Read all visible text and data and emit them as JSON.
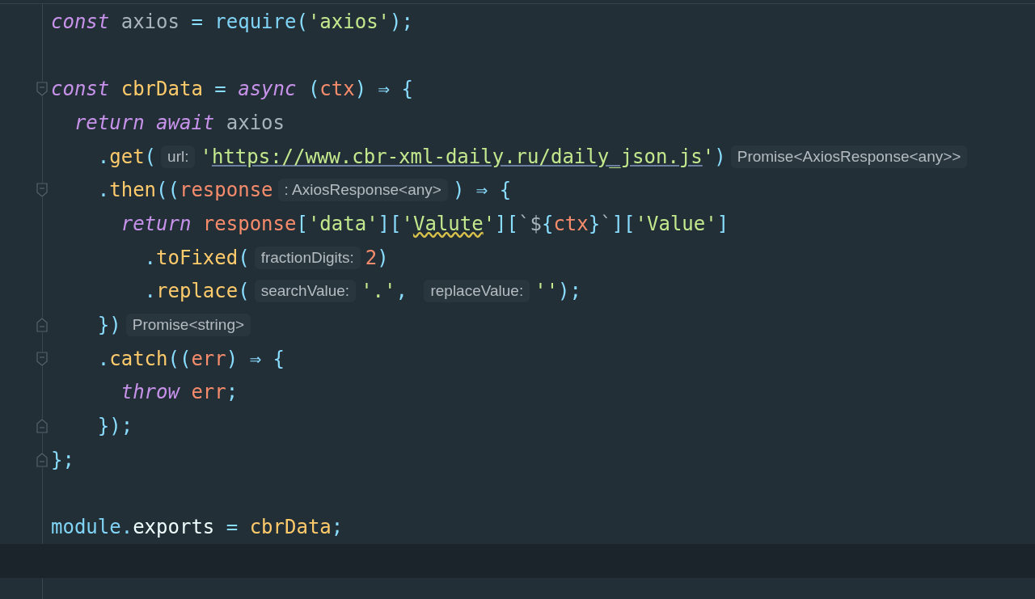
{
  "editor": {
    "lines": [
      {
        "fold_start": false,
        "fold_end": false,
        "current": false,
        "tokens": [
          {
            "text": "const",
            "kind": "keyword"
          },
          {
            "text": " axios ",
            "kind": "variable"
          },
          {
            "text": "=",
            "kind": "operator"
          },
          {
            "text": " require",
            "kind": "function"
          },
          {
            "text": "(",
            "kind": "punct"
          },
          {
            "text": "'axios'",
            "kind": "string"
          },
          {
            "text": ");",
            "kind": "punct"
          }
        ]
      },
      {
        "fold_start": false,
        "fold_end": false,
        "current": false
      },
      {
        "fold_start": true,
        "fold_end": false,
        "current": false,
        "tokens": [
          {
            "text": "const",
            "kind": "keyword"
          },
          {
            "text": " cbrData ",
            "kind": "name"
          },
          {
            "text": "= ",
            "kind": "operator"
          },
          {
            "text": "async",
            "kind": "keyword"
          },
          {
            "text": " (",
            "kind": "punct"
          },
          {
            "text": "ctx",
            "kind": "param"
          },
          {
            "text": ") ⇒ {",
            "kind": "punct"
          }
        ]
      },
      {
        "fold_start": false,
        "fold_end": false,
        "current": false,
        "tokens": [
          {
            "text": "  return await",
            "kind": "keyword"
          },
          {
            "text": " axios",
            "kind": "variable"
          }
        ]
      },
      {
        "fold_start": false,
        "fold_end": false,
        "current": false,
        "tokens": [
          {
            "text": "    .",
            "kind": "punct"
          },
          {
            "text": "get",
            "kind": "method"
          },
          {
            "text": "(",
            "kind": "punct"
          },
          {
            "text": "url:",
            "kind": "hint"
          },
          {
            "text": "'",
            "kind": "string"
          },
          {
            "text": "https://www.cbr-xml-daily.ru/daily_json.js",
            "kind": "url"
          },
          {
            "text": "'",
            "kind": "string"
          },
          {
            "text": ")",
            "kind": "punct"
          },
          {
            "text": "Promise<AxiosResponse<any>>",
            "kind": "hint"
          }
        ]
      },
      {
        "fold_start": true,
        "fold_end": false,
        "current": false,
        "tokens": [
          {
            "text": "    .",
            "kind": "punct"
          },
          {
            "text": "then",
            "kind": "method"
          },
          {
            "text": "((",
            "kind": "punct"
          },
          {
            "text": "response",
            "kind": "param"
          },
          {
            "text": ": AxiosResponse<any>",
            "kind": "hint"
          },
          {
            "text": ") ⇒ {",
            "kind": "punct"
          }
        ]
      },
      {
        "fold_start": false,
        "fold_end": false,
        "current": false,
        "tokens": [
          {
            "text": "      return",
            "kind": "keyword"
          },
          {
            "text": " response",
            "kind": "param"
          },
          {
            "text": "[",
            "kind": "punct"
          },
          {
            "text": "'data'",
            "kind": "string"
          },
          {
            "text": "][",
            "kind": "punct"
          },
          {
            "text": "'",
            "kind": "string"
          },
          {
            "text": "Valute",
            "kind": "warning"
          },
          {
            "text": "'",
            "kind": "string"
          },
          {
            "text": "][",
            "kind": "punct"
          },
          {
            "text": "`$",
            "kind": "variable"
          },
          {
            "text": "{",
            "kind": "punct"
          },
          {
            "text": "ctx",
            "kind": "param"
          },
          {
            "text": "}",
            "kind": "punct"
          },
          {
            "text": "`",
            "kind": "variable"
          },
          {
            "text": "][",
            "kind": "punct"
          },
          {
            "text": "'Value'",
            "kind": "string"
          },
          {
            "text": "]",
            "kind": "punct"
          }
        ]
      },
      {
        "fold_start": false,
        "fold_end": false,
        "current": false,
        "tokens": [
          {
            "text": "        .",
            "kind": "punct"
          },
          {
            "text": "toFixed",
            "kind": "method"
          },
          {
            "text": "(",
            "kind": "punct"
          },
          {
            "text": "fractionDigits:",
            "kind": "hint"
          },
          {
            "text": "2",
            "kind": "number"
          },
          {
            "text": ")",
            "kind": "punct"
          }
        ]
      },
      {
        "fold_start": false,
        "fold_end": false,
        "current": false,
        "tokens": [
          {
            "text": "        .",
            "kind": "punct"
          },
          {
            "text": "replace",
            "kind": "method"
          },
          {
            "text": "(",
            "kind": "punct"
          },
          {
            "text": "searchValue:",
            "kind": "hint"
          },
          {
            "text": "'.'",
            "kind": "string"
          },
          {
            "text": ", ",
            "kind": "punct"
          },
          {
            "text": "replaceValue:",
            "kind": "hint"
          },
          {
            "text": "''",
            "kind": "string"
          },
          {
            "text": ");",
            "kind": "punct"
          }
        ]
      },
      {
        "fold_start": false,
        "fold_end": true,
        "current": false,
        "tokens": [
          {
            "text": "    })",
            "kind": "punct"
          },
          {
            "text": "Promise<string>",
            "kind": "hint"
          }
        ]
      },
      {
        "fold_start": true,
        "fold_end": false,
        "current": false,
        "tokens": [
          {
            "text": "    .",
            "kind": "punct"
          },
          {
            "text": "catch",
            "kind": "method"
          },
          {
            "text": "((",
            "kind": "punct"
          },
          {
            "text": "err",
            "kind": "param"
          },
          {
            "text": ") ⇒ {",
            "kind": "punct"
          }
        ]
      },
      {
        "fold_start": false,
        "fold_end": false,
        "current": false,
        "tokens": [
          {
            "text": "      throw",
            "kind": "keyword"
          },
          {
            "text": " err",
            "kind": "param"
          },
          {
            "text": ";",
            "kind": "punct"
          }
        ]
      },
      {
        "fold_start": false,
        "fold_end": true,
        "current": false,
        "tokens": [
          {
            "text": "    });",
            "kind": "punct"
          }
        ]
      },
      {
        "fold_start": false,
        "fold_end": true,
        "current": false,
        "tokens": [
          {
            "text": "};",
            "kind": "punct"
          }
        ]
      },
      {
        "fold_start": false,
        "fold_end": false,
        "current": false
      },
      {
        "fold_start": false,
        "fold_end": false,
        "current": false,
        "tokens": [
          {
            "text": "module.",
            "kind": "module"
          },
          {
            "text": "exports ",
            "kind": "property"
          },
          {
            "text": "=",
            "kind": "operator"
          },
          {
            "text": " cbrData",
            "kind": "name"
          },
          {
            "text": ";",
            "kind": "punct"
          }
        ]
      },
      {
        "fold_start": false,
        "fold_end": false,
        "current": true
      }
    ]
  }
}
